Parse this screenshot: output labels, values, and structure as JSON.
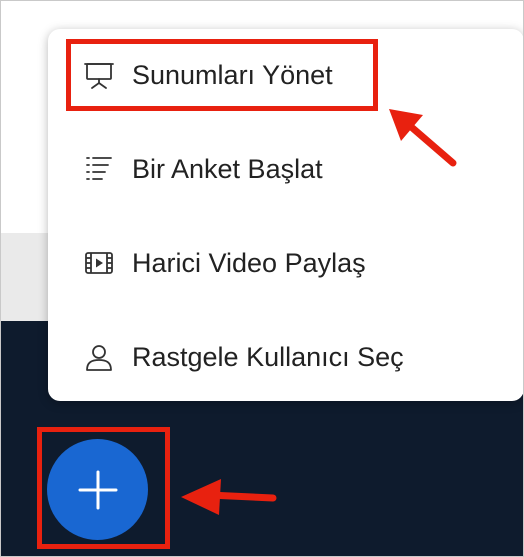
{
  "menu": {
    "items": [
      {
        "label": "Sunumları Yönet",
        "icon": "presentation-icon"
      },
      {
        "label": "Bir Anket Başlat",
        "icon": "list-icon"
      },
      {
        "label": "Harici Video Paylaş",
        "icon": "video-icon"
      },
      {
        "label": "Rastgele Kullanıcı Seç",
        "icon": "user-icon"
      }
    ]
  },
  "fab": {
    "icon": "plus-icon"
  },
  "colors": {
    "accent": "#1967d2",
    "annotation": "#e8210f",
    "footer_bg": "#0e1b2d"
  }
}
